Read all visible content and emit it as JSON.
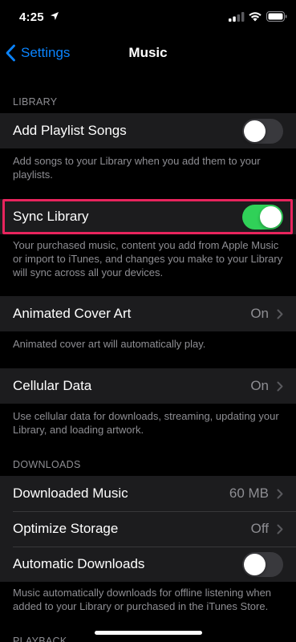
{
  "status_bar": {
    "time": "4:25"
  },
  "nav": {
    "back_label": "Settings",
    "title": "Music"
  },
  "library": {
    "header": "LIBRARY",
    "add_playlist_songs": {
      "label": "Add Playlist Songs",
      "state": "off"
    },
    "add_playlist_songs_footer": "Add songs to your Library when you add them to your playlists.",
    "sync_library": {
      "label": "Sync Library",
      "state": "on"
    },
    "sync_library_footer": "Your purchased music, content you add from Apple Music or import to iTunes, and changes you make to your Library will sync across all your devices."
  },
  "animated_cover_art": {
    "label": "Animated Cover Art",
    "value": "On",
    "footer": "Animated cover art will automatically play."
  },
  "cellular_data": {
    "label": "Cellular Data",
    "value": "On",
    "footer": "Use cellular data for downloads, streaming, updating your Library, and loading artwork."
  },
  "downloads": {
    "header": "DOWNLOADS",
    "downloaded_music": {
      "label": "Downloaded Music",
      "value": "60 MB"
    },
    "optimize_storage": {
      "label": "Optimize Storage",
      "value": "Off"
    },
    "automatic_downloads": {
      "label": "Automatic Downloads",
      "state": "off"
    },
    "footer": "Music automatically downloads for offline listening when added to your Library or purchased in the iTunes Store."
  },
  "playback": {
    "header": "PLAYBACK"
  },
  "colors": {
    "accent": "#0a84ff",
    "toggle_on": "#30d158",
    "highlight": "#e8245d"
  }
}
